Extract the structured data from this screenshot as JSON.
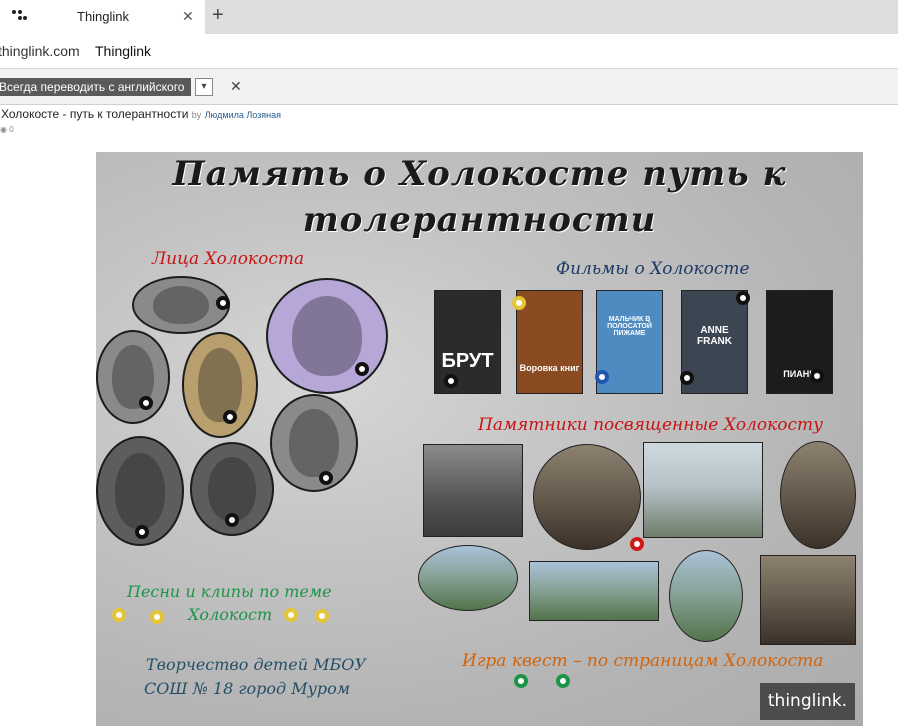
{
  "browser": {
    "tab_title": "Thinglink",
    "tab_close_icon": "close-icon",
    "new_tab_icon": "plus-icon",
    "url_domain": "thinglink.com",
    "url_page_title": "Thinglink"
  },
  "translate_bar": {
    "always_translate_label": "Всегда переводить с английского",
    "dropdown_icon": "chevron-down-icon",
    "close_icon": "close-icon"
  },
  "page_header": {
    "title": "Холокосте - путь к толерантности",
    "by": "by",
    "author": "Людмила Лозяная",
    "view_icon": "eye-icon",
    "views": "0"
  },
  "canvas": {
    "title_line1": "Память о Холокосте путь к",
    "title_line2": "толерантности",
    "faces_heading": "Лица Холокоста",
    "films_heading": "Фильмы о Холокосте",
    "monuments_heading": "Памятники посвященные Холокосту",
    "songs_heading_line1": "Песни и клипы по теме",
    "songs_heading_line2": "Холокост",
    "creativity_line1": "Творчество детей МБОУ",
    "creativity_line2": "СОШ № 18 город Муром",
    "quest_heading": "Игра квест – по страницам Холокоста",
    "films": [
      {
        "title": "БРУТ",
        "color": "#2b2b2b"
      },
      {
        "title": "Воровка книг",
        "color": "#8a4a22"
      },
      {
        "title": "МАЛЬЧИК В ПОЛОСАТОЙ ПИЖАМЕ",
        "color": "#4d8bc0"
      },
      {
        "title": "ANNE FRANK",
        "color": "#3c4552"
      },
      {
        "title": "ПИАНИ",
        "color": "#1c1c1c"
      }
    ],
    "colors": {
      "hotspot_black": "#111111",
      "hotspot_yellow": "#e5c534",
      "hotspot_blue": "#2156b3",
      "hotspot_red": "#d11a1a",
      "hotspot_green": "#1d9448"
    },
    "badge": "thinglink."
  }
}
